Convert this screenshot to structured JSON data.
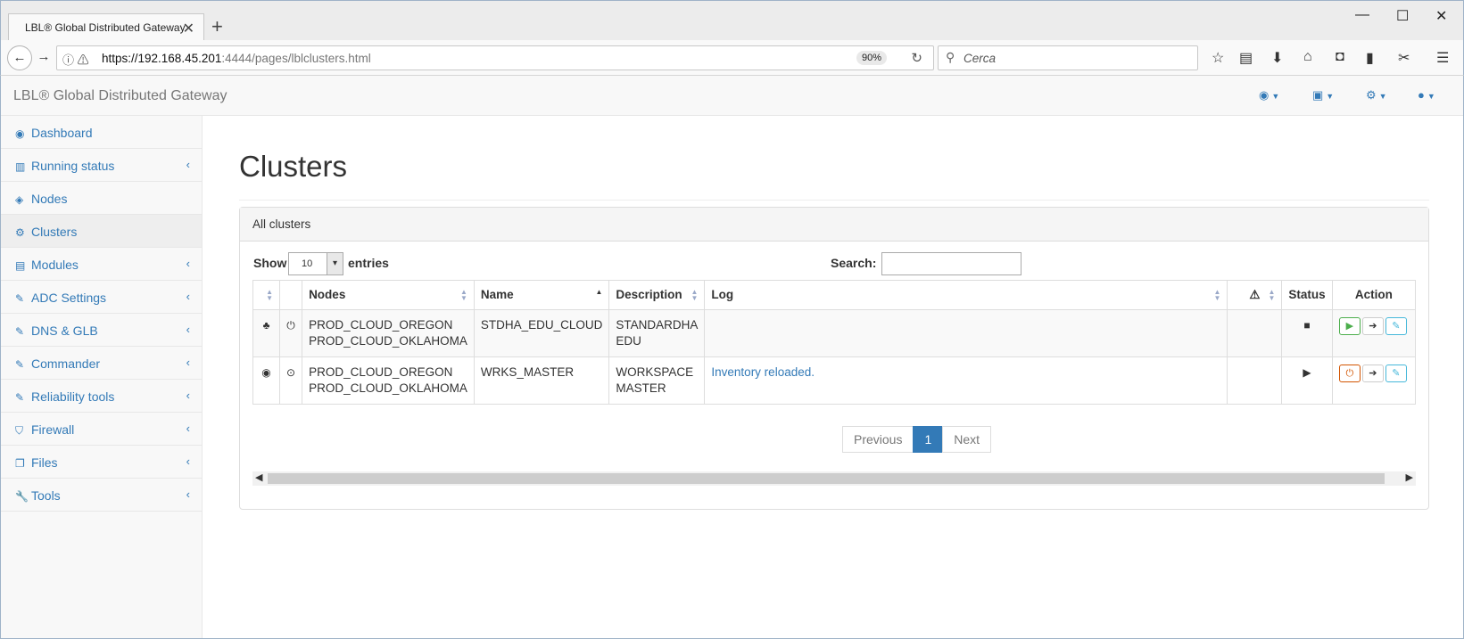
{
  "browser": {
    "tab_title": "LBL® Global Distributed Gateway",
    "url_host": "https://192.168.45.201",
    "url_rest": ":4444/pages/lblclusters.html",
    "zoom": "90%",
    "search_placeholder": "Cerca"
  },
  "app": {
    "brand": "LBL® Global Distributed Gateway"
  },
  "sidebar": {
    "items": [
      {
        "label": "Dashboard",
        "icon": "dashboard-icon"
      },
      {
        "label": "Running status",
        "icon": "bar-chart-icon"
      },
      {
        "label": "Nodes",
        "icon": "cube-icon"
      },
      {
        "label": "Clusters",
        "icon": "cogs-icon"
      },
      {
        "label": "Modules",
        "icon": "list-icon"
      },
      {
        "label": "ADC Settings",
        "icon": "edit-icon"
      },
      {
        "label": "DNS & GLB",
        "icon": "edit-icon"
      },
      {
        "label": "Commander",
        "icon": "edit-icon"
      },
      {
        "label": "Reliability tools",
        "icon": "edit-icon"
      },
      {
        "label": "Firewall",
        "icon": "shield-icon"
      },
      {
        "label": "Files",
        "icon": "files-icon"
      },
      {
        "label": "Tools",
        "icon": "wrench-icon"
      }
    ]
  },
  "main": {
    "title": "Clusters",
    "panel_title": "All clusters",
    "show_label": "Show",
    "entries_value": "10",
    "entries_label": "entries",
    "search_label": "Search:",
    "columns": {
      "nodes": "Nodes",
      "name": "Name",
      "description": "Description",
      "log": "Log",
      "status": "Status",
      "action": "Action"
    },
    "rows": [
      {
        "nodes_line1": "PROD_CLOUD_OREGON",
        "nodes_line2": "PROD_CLOUD_OKLAHOMA",
        "name": "STDHA_EDU_CLOUD",
        "desc_line1": "STANDARDHA",
        "desc_line2": "EDU",
        "log": ""
      },
      {
        "nodes_line1": "PROD_CLOUD_OREGON",
        "nodes_line2": "PROD_CLOUD_OKLAHOMA",
        "name": "WRKS_MASTER",
        "desc_line1": "WORKSPACE",
        "desc_line2": "MASTER",
        "log": "Inventory reloaded."
      }
    ],
    "pagination": {
      "previous": "Previous",
      "current": "1",
      "next": "Next"
    }
  }
}
